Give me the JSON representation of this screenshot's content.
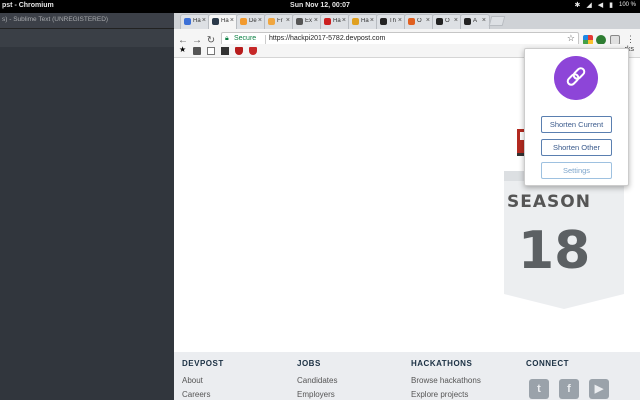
{
  "os": {
    "app_title": "pst - Chromium",
    "clock": "Sun Nov 12, 00:07",
    "battery": "100 %"
  },
  "sublime": {
    "title": "s) - Sublime Text (UNREGISTERED)"
  },
  "browser": {
    "tabs": [
      {
        "label": "Ha",
        "color": "#3b6fd6"
      },
      {
        "label": "Ha",
        "color": "#2b3a4a"
      },
      {
        "label": "De",
        "color": "#f29a2e"
      },
      {
        "label": "Fr",
        "color": "#f0a640"
      },
      {
        "label": "Ex",
        "color": "#555555"
      },
      {
        "label": "Ha",
        "color": "#cc2020"
      },
      {
        "label": "Ha",
        "color": "#e0a020"
      },
      {
        "label": "Th",
        "color": "#222222"
      },
      {
        "label": "O",
        "color": "#e06020"
      },
      {
        "label": "O",
        "color": "#222222"
      },
      {
        "label": "A",
        "color": "#222222"
      }
    ],
    "tab_close": "×",
    "omnibox": {
      "secure_label": "Secure",
      "url": "https://hackpi2017-5782.devpost.com"
    },
    "bookmarks_bar_trailing": "rks"
  },
  "page": {
    "season_label": "SEASON",
    "season_number": "18",
    "footer": {
      "columns": [
        {
          "heading": "DEVPOST",
          "links": [
            "About",
            "Careers"
          ]
        },
        {
          "heading": "JOBS",
          "links": [
            "Candidates",
            "Employers"
          ]
        },
        {
          "heading": "HACKATHONS",
          "links": [
            "Browse hackathons",
            "Explore projects"
          ]
        },
        {
          "heading": "CONNECT",
          "links": []
        }
      ],
      "social": [
        "twitter-icon",
        "facebook-icon",
        "youtube-icon"
      ]
    }
  },
  "popup": {
    "shorten_current": "Shorten Current",
    "shorten_other": "Shorten Other",
    "settings": "Settings",
    "logo_color": "#8d45d8"
  }
}
